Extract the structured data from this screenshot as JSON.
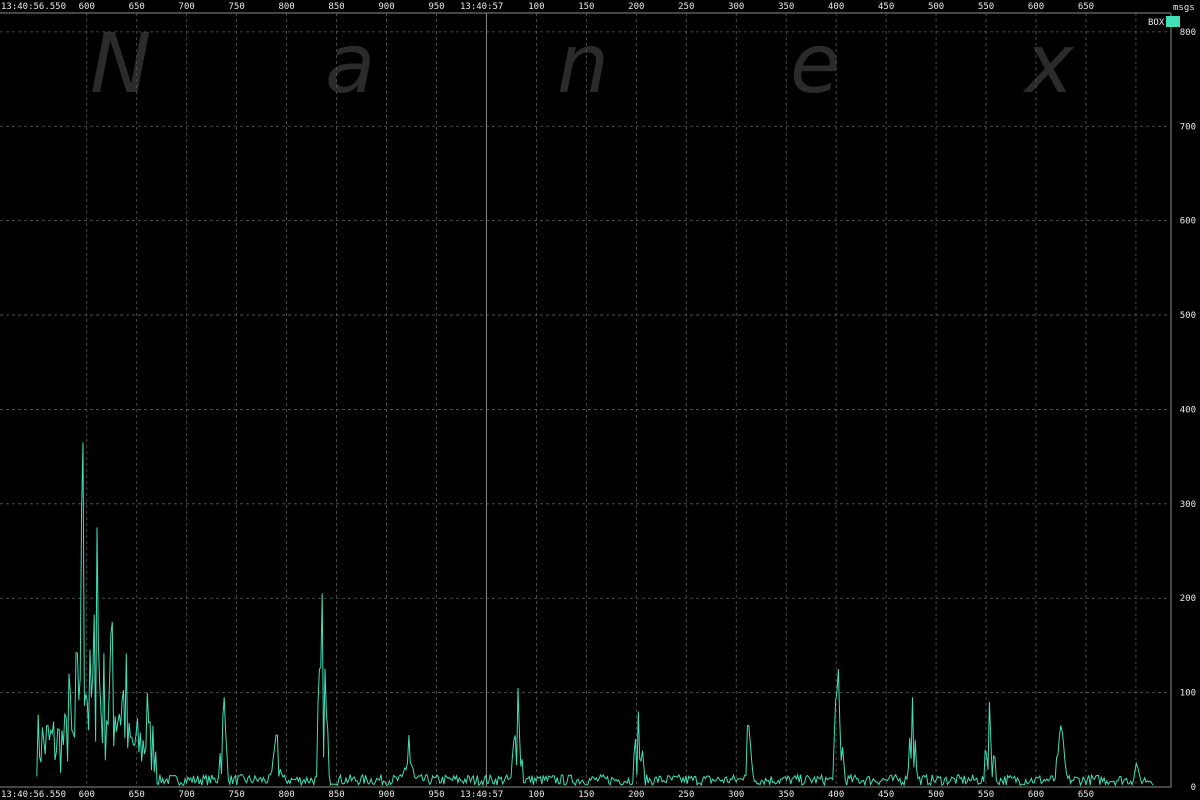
{
  "watermark": [
    "N",
    "a",
    "n",
    "e",
    "x"
  ],
  "chart_data": {
    "type": "line",
    "title": "",
    "xlabel": "",
    "ylabel": "msgs",
    "ylim": [
      0,
      820
    ],
    "yticks": [
      0,
      100,
      200,
      300,
      400,
      500,
      600,
      700,
      800
    ],
    "grid": true,
    "legend_position": "top-right",
    "series": [
      {
        "name": "BOX",
        "color": "#40e0b8"
      }
    ],
    "x_axis": {
      "start_label": "13:40:56.550",
      "second_label": "13:40:57",
      "top_ticks": [
        "600",
        "650",
        "700",
        "750",
        "800",
        "850",
        "900",
        "950",
        "50",
        "100",
        "150",
        "200",
        "250",
        "300",
        "350",
        "400",
        "450",
        "500",
        "550",
        "600",
        "650"
      ],
      "bottom_ticks": [
        "600",
        "650",
        "700",
        "750",
        "800",
        "850",
        "900",
        "950",
        "50",
        "100",
        "150",
        "200",
        "250",
        "300",
        "350",
        "400",
        "450",
        "500",
        "550",
        "600",
        "650"
      ],
      "range_ms": [
        550,
        1667
      ],
      "second_boundary_ms": 1000
    },
    "peaks": [
      {
        "t_ms": 582,
        "v": 120
      },
      {
        "t_ms": 596,
        "v": 365
      },
      {
        "t_ms": 610,
        "v": 275
      },
      {
        "t_ms": 625,
        "v": 175
      },
      {
        "t_ms": 660,
        "v": 100
      },
      {
        "t_ms": 737,
        "v": 95
      },
      {
        "t_ms": 790,
        "v": 55
      },
      {
        "t_ms": 836,
        "v": 205
      },
      {
        "t_ms": 922,
        "v": 55
      },
      {
        "t_ms": 1031,
        "v": 105
      },
      {
        "t_ms": 1152,
        "v": 80
      },
      {
        "t_ms": 1262,
        "v": 65
      },
      {
        "t_ms": 1352,
        "v": 125
      },
      {
        "t_ms": 1426,
        "v": 95
      },
      {
        "t_ms": 1504,
        "v": 90
      },
      {
        "t_ms": 1575,
        "v": 65
      },
      {
        "t_ms": 1650,
        "v": 25
      }
    ]
  }
}
